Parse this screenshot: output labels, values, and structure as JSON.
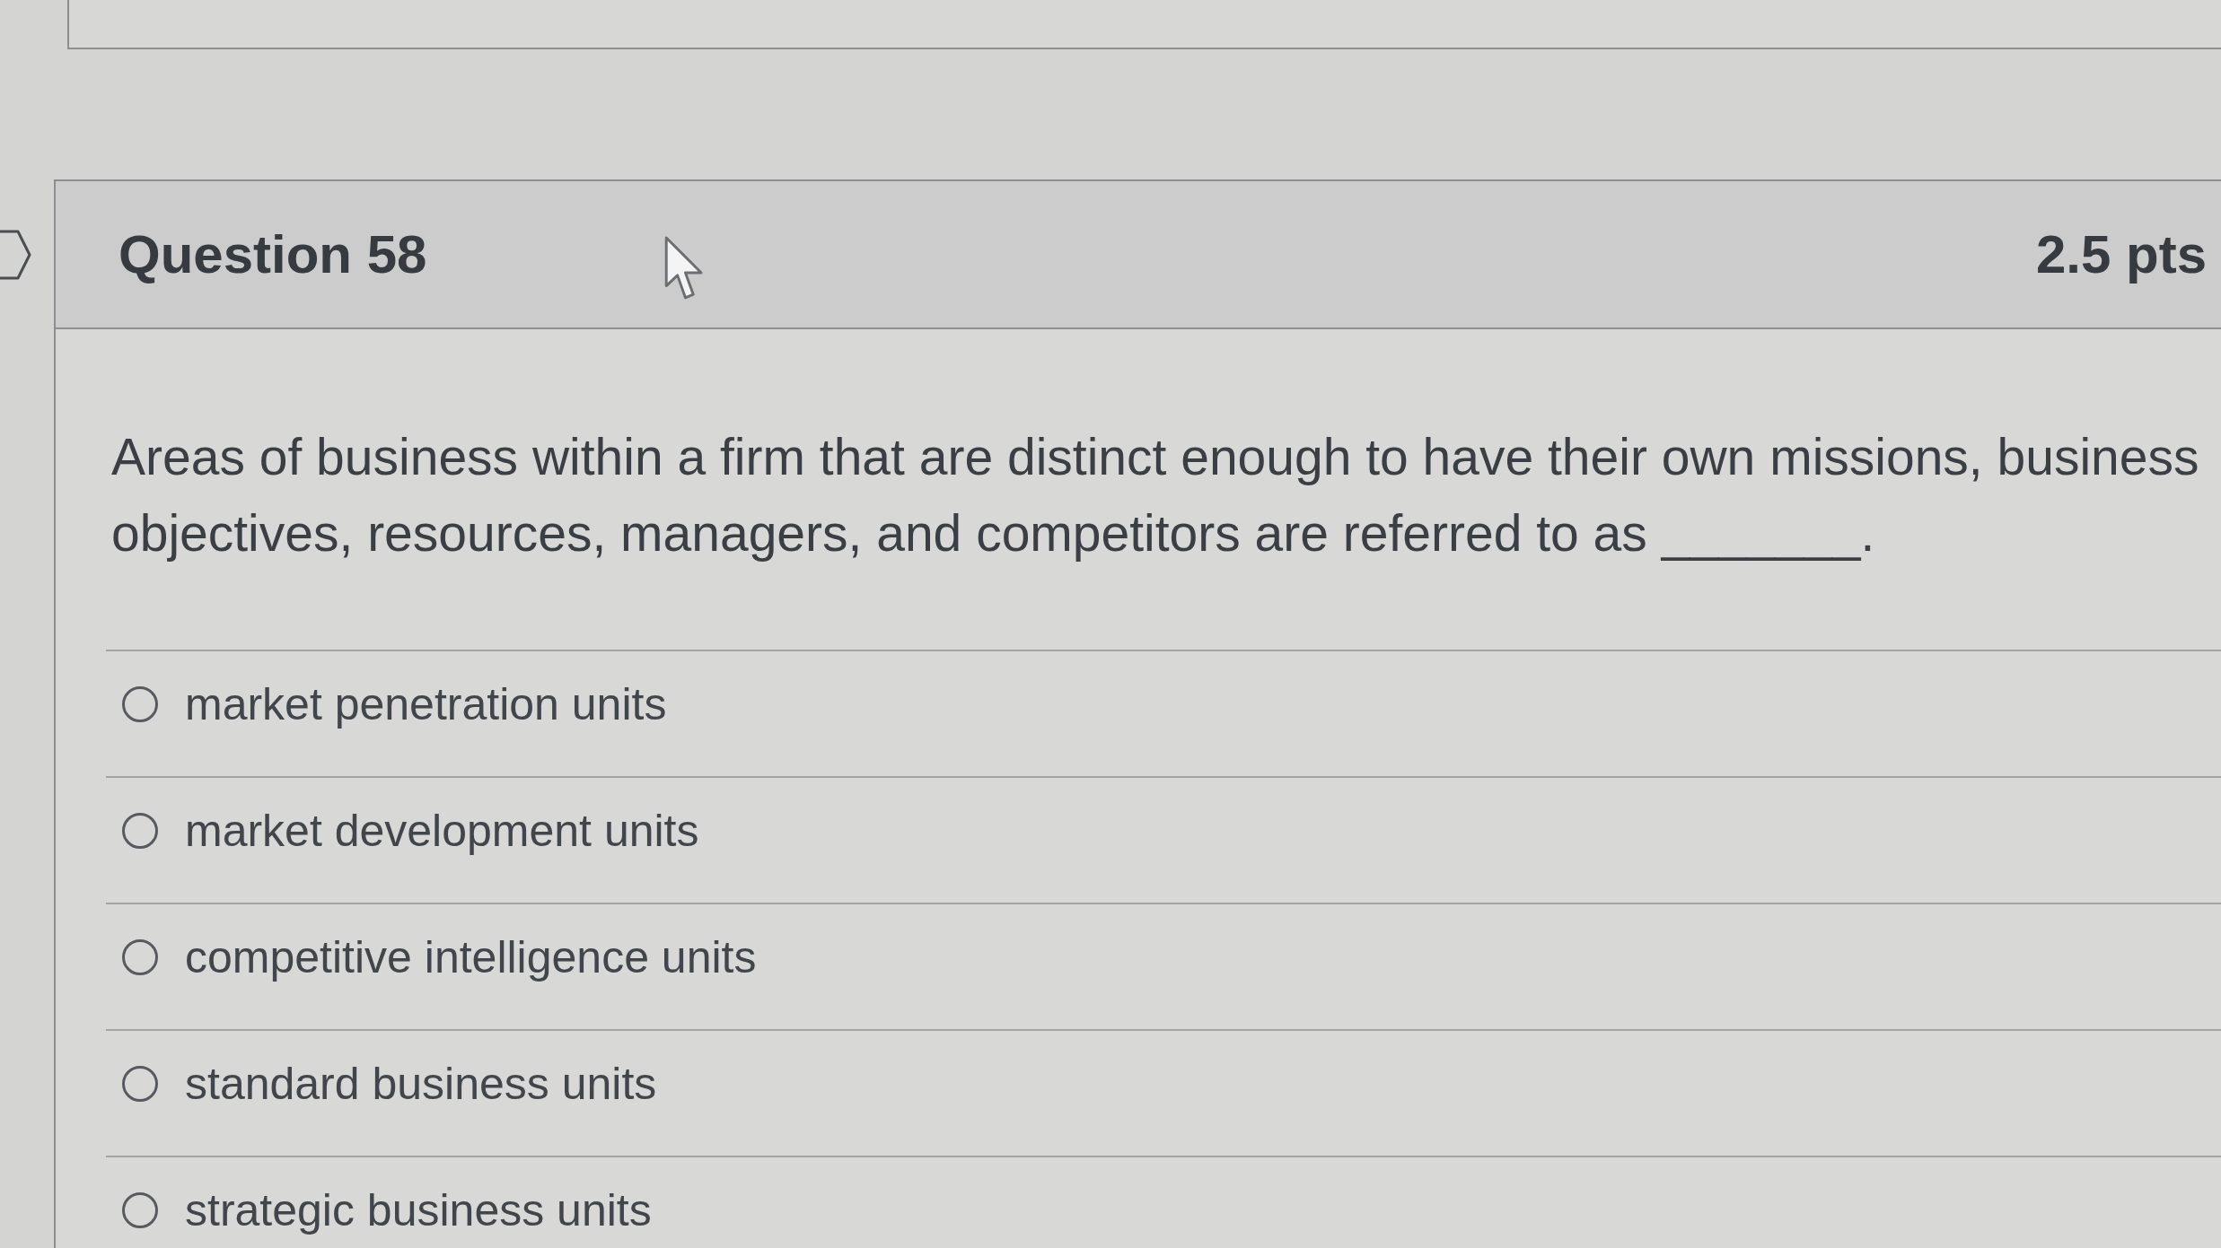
{
  "question": {
    "title": "Question 58",
    "points": "2.5 pts",
    "text": "Areas of business within a firm that are distinct enough to have their own missions, business objectives, resources, managers, and competitors are referred to as _______.",
    "options": [
      {
        "label": "market penetration units",
        "selected": false
      },
      {
        "label": "market development units",
        "selected": false
      },
      {
        "label": "competitive intelligence units",
        "selected": false
      },
      {
        "label": "standard business units",
        "selected": false
      },
      {
        "label": "strategic business units",
        "selected": false
      }
    ]
  }
}
